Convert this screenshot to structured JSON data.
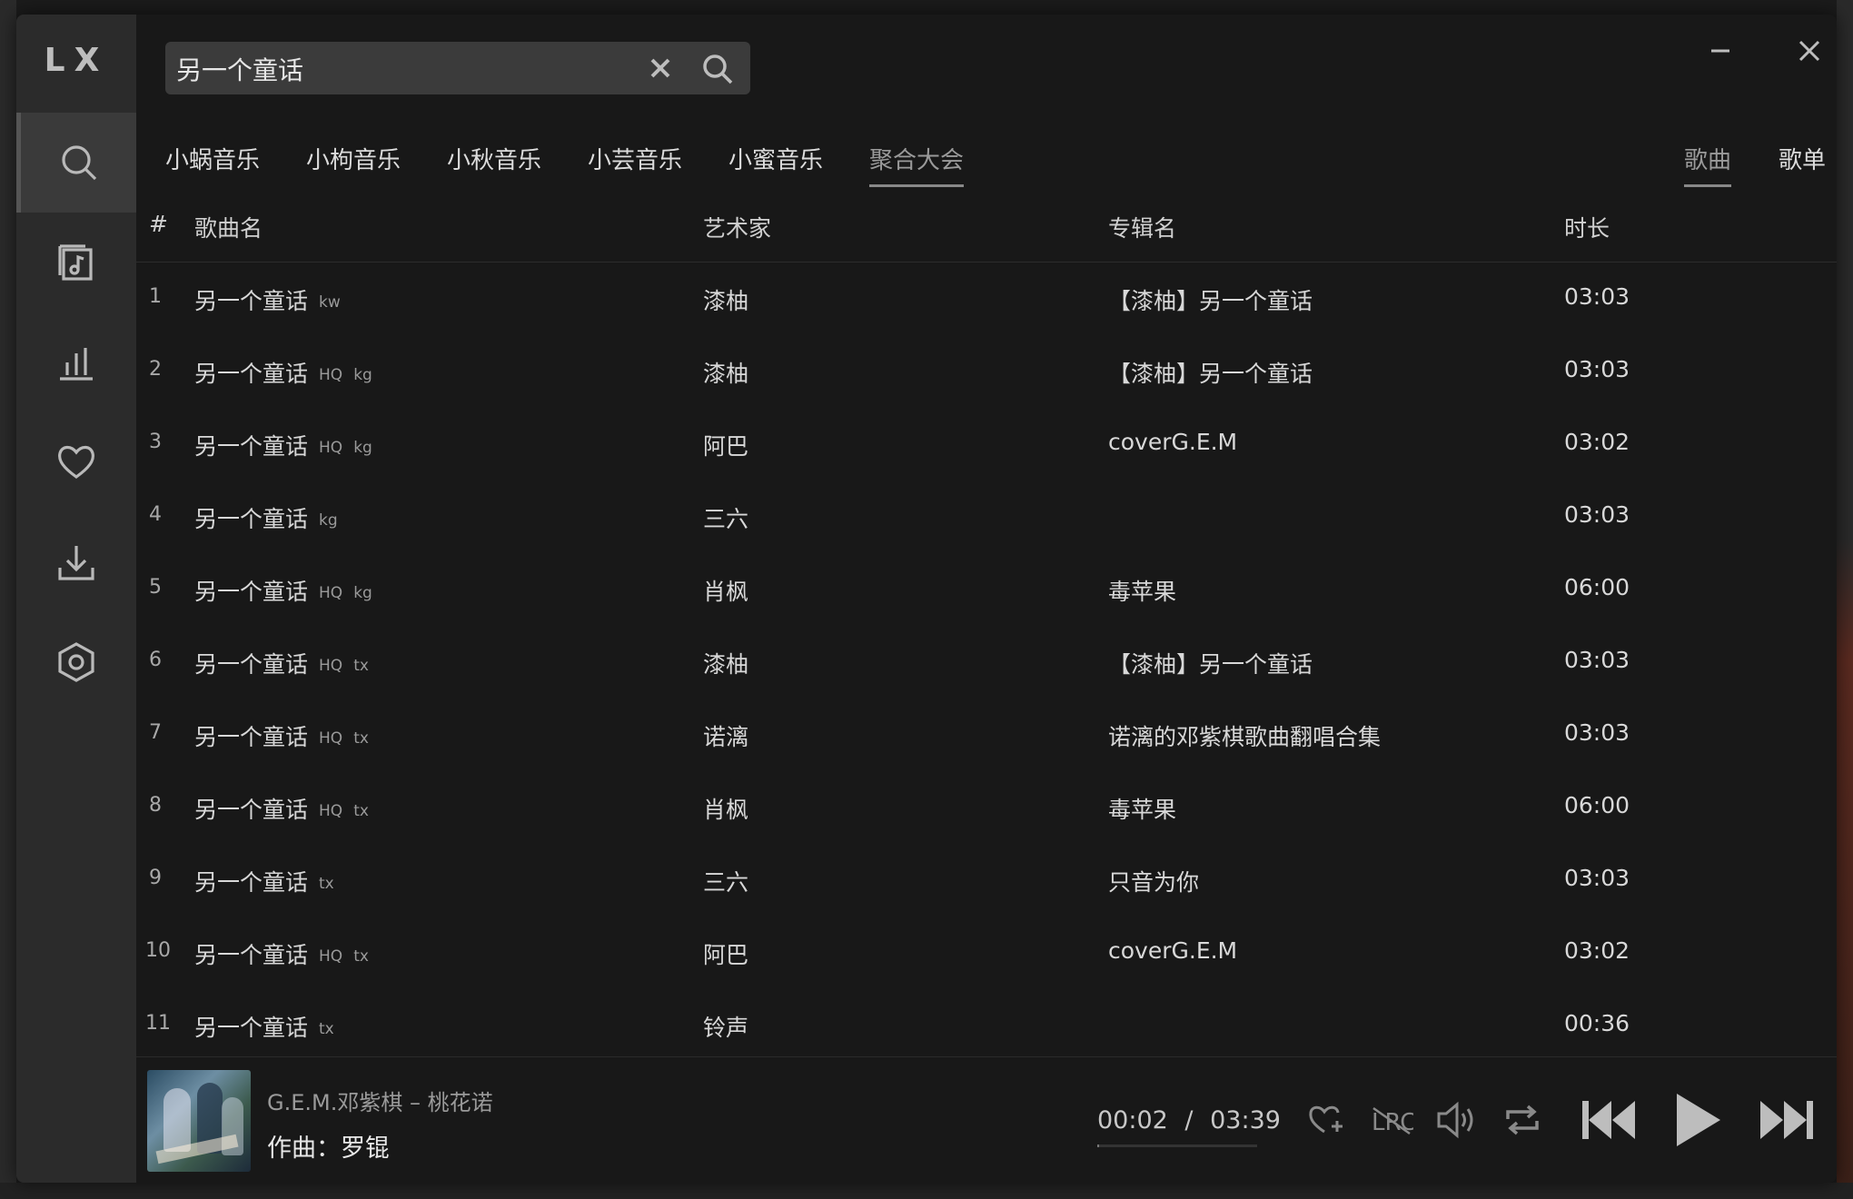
{
  "app": {
    "logo": "LX"
  },
  "sidebar": {
    "items": [
      {
        "name": "search",
        "icon": "search-icon",
        "active": true
      },
      {
        "name": "song-list",
        "icon": "music-list-icon",
        "active": false
      },
      {
        "name": "leaderboard",
        "icon": "bar-chart-icon",
        "active": false
      },
      {
        "name": "my-list",
        "icon": "heart-icon",
        "active": false
      },
      {
        "name": "download",
        "icon": "download-icon",
        "active": false
      },
      {
        "name": "settings",
        "icon": "settings-icon",
        "active": false
      }
    ]
  },
  "search": {
    "value": "另一个童话",
    "placeholder": ""
  },
  "source_tabs": [
    "小蜗音乐",
    "小枸音乐",
    "小秋音乐",
    "小芸音乐",
    "小蜜音乐",
    "聚合大会"
  ],
  "source_active": "聚合大会",
  "type_tabs": [
    "歌曲",
    "歌单"
  ],
  "type_active": "歌曲",
  "table": {
    "headers": {
      "num": "#",
      "name": "歌曲名",
      "artist": "艺术家",
      "album": "专辑名",
      "duration": "时长"
    },
    "rows": [
      {
        "num": "1",
        "name": "另一个童话",
        "badges": [
          "kw"
        ],
        "artist": "漆柚",
        "album": "【漆柚】另一个童话",
        "duration": "03:03"
      },
      {
        "num": "2",
        "name": "另一个童话",
        "badges": [
          "HQ",
          "kg"
        ],
        "artist": "漆柚",
        "album": "【漆柚】另一个童话",
        "duration": "03:03"
      },
      {
        "num": "3",
        "name": "另一个童话",
        "badges": [
          "HQ",
          "kg"
        ],
        "artist": "阿巴",
        "album": "coverG.E.M",
        "duration": "03:02"
      },
      {
        "num": "4",
        "name": "另一个童话",
        "badges": [
          "kg"
        ],
        "artist": "三六",
        "album": "",
        "duration": "03:03"
      },
      {
        "num": "5",
        "name": "另一个童话",
        "badges": [
          "HQ",
          "kg"
        ],
        "artist": "肖枫",
        "album": "毒苹果",
        "duration": "06:00"
      },
      {
        "num": "6",
        "name": "另一个童话",
        "badges": [
          "HQ",
          "tx"
        ],
        "artist": "漆柚",
        "album": "【漆柚】另一个童话",
        "duration": "03:03"
      },
      {
        "num": "7",
        "name": "另一个童话",
        "badges": [
          "HQ",
          "tx"
        ],
        "artist": "诺漓",
        "album": "诺漓的邓紫棋歌曲翻唱合集",
        "duration": "03:03"
      },
      {
        "num": "8",
        "name": "另一个童话",
        "badges": [
          "HQ",
          "tx"
        ],
        "artist": "肖枫",
        "album": "毒苹果",
        "duration": "06:00"
      },
      {
        "num": "9",
        "name": "另一个童话",
        "badges": [
          "tx"
        ],
        "artist": "三六",
        "album": "只音为你",
        "duration": "03:03"
      },
      {
        "num": "10",
        "name": "另一个童话",
        "badges": [
          "HQ",
          "tx"
        ],
        "artist": "阿巴",
        "album": "coverG.E.M",
        "duration": "03:02"
      },
      {
        "num": "11",
        "name": "另一个童话",
        "badges": [
          "tx"
        ],
        "artist": "铃声",
        "album": "",
        "duration": "00:36"
      }
    ]
  },
  "player": {
    "title": "G.E.M.邓紫棋 – 桃花诺",
    "lyric": "作曲：罗锟",
    "current_time": "00:02",
    "separator": "/",
    "total_time": "03:39",
    "progress": 0.009,
    "lrc_label": "LRC"
  }
}
